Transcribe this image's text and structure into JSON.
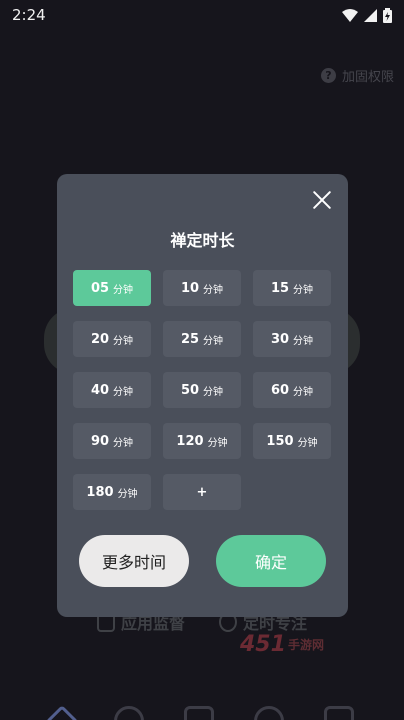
{
  "status_bar": {
    "time": "2:24",
    "icons": [
      "wifi-icon",
      "signal-icon",
      "battery-icon"
    ]
  },
  "background": {
    "permission_label": "加固权限",
    "actions": [
      {
        "label": "应用监督",
        "icon": "app-monitor-icon"
      },
      {
        "label": "定时专注",
        "icon": "timer-icon"
      }
    ],
    "watermark": {
      "main": "451",
      "sub": "手游网"
    }
  },
  "dialog": {
    "title": "禅定时长",
    "options": [
      {
        "num": "05",
        "unit": "分钟",
        "selected": true
      },
      {
        "num": "10",
        "unit": "分钟",
        "selected": false
      },
      {
        "num": "15",
        "unit": "分钟",
        "selected": false
      },
      {
        "num": "20",
        "unit": "分钟",
        "selected": false
      },
      {
        "num": "25",
        "unit": "分钟",
        "selected": false
      },
      {
        "num": "30",
        "unit": "分钟",
        "selected": false
      },
      {
        "num": "40",
        "unit": "分钟",
        "selected": false
      },
      {
        "num": "50",
        "unit": "分钟",
        "selected": false
      },
      {
        "num": "60",
        "unit": "分钟",
        "selected": false
      },
      {
        "num": "90",
        "unit": "分钟",
        "selected": false
      },
      {
        "num": "120",
        "unit": "分钟",
        "selected": false
      },
      {
        "num": "150",
        "unit": "分钟",
        "selected": false
      },
      {
        "num": "180",
        "unit": "分钟",
        "selected": false
      },
      {
        "num": "+",
        "unit": "",
        "selected": false
      }
    ],
    "more_time_label": "更多时间",
    "confirm_label": "确定"
  },
  "colors": {
    "accent": "#5dc99a",
    "dialog_bg": "#4a4f5a",
    "option_bg": "#555a65",
    "screen_bg": "#16151c"
  }
}
